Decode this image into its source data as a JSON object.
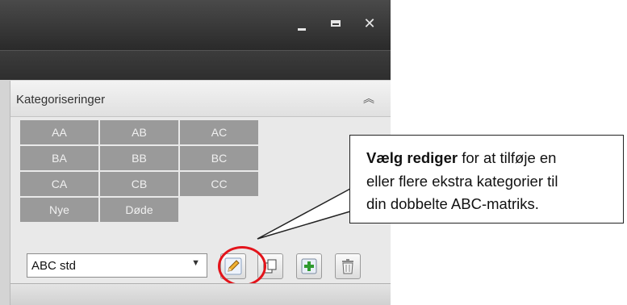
{
  "panel": {
    "title": "Kategoriseringer",
    "categories": [
      "AA",
      "AB",
      "AC",
      "BA",
      "BB",
      "BC",
      "CA",
      "CB",
      "CC",
      "Nye",
      "Døde"
    ],
    "preset_select": {
      "value": "ABC std"
    }
  },
  "callout": {
    "bold": "Vælg rediger",
    "lines": [
      "for at tilføje en",
      "eller flere ekstra kategorier til",
      "din dobbelte ABC-matriks."
    ]
  },
  "colors": {
    "highlight_circle": "#e3141b",
    "category_cell": "#9a9a9a"
  },
  "icons": [
    "minimize-icon",
    "maximize-icon",
    "close-icon",
    "collapse-icon",
    "dropdown-arrow-icon",
    "pencil-icon",
    "copy-icon",
    "add-icon",
    "trash-icon"
  ]
}
